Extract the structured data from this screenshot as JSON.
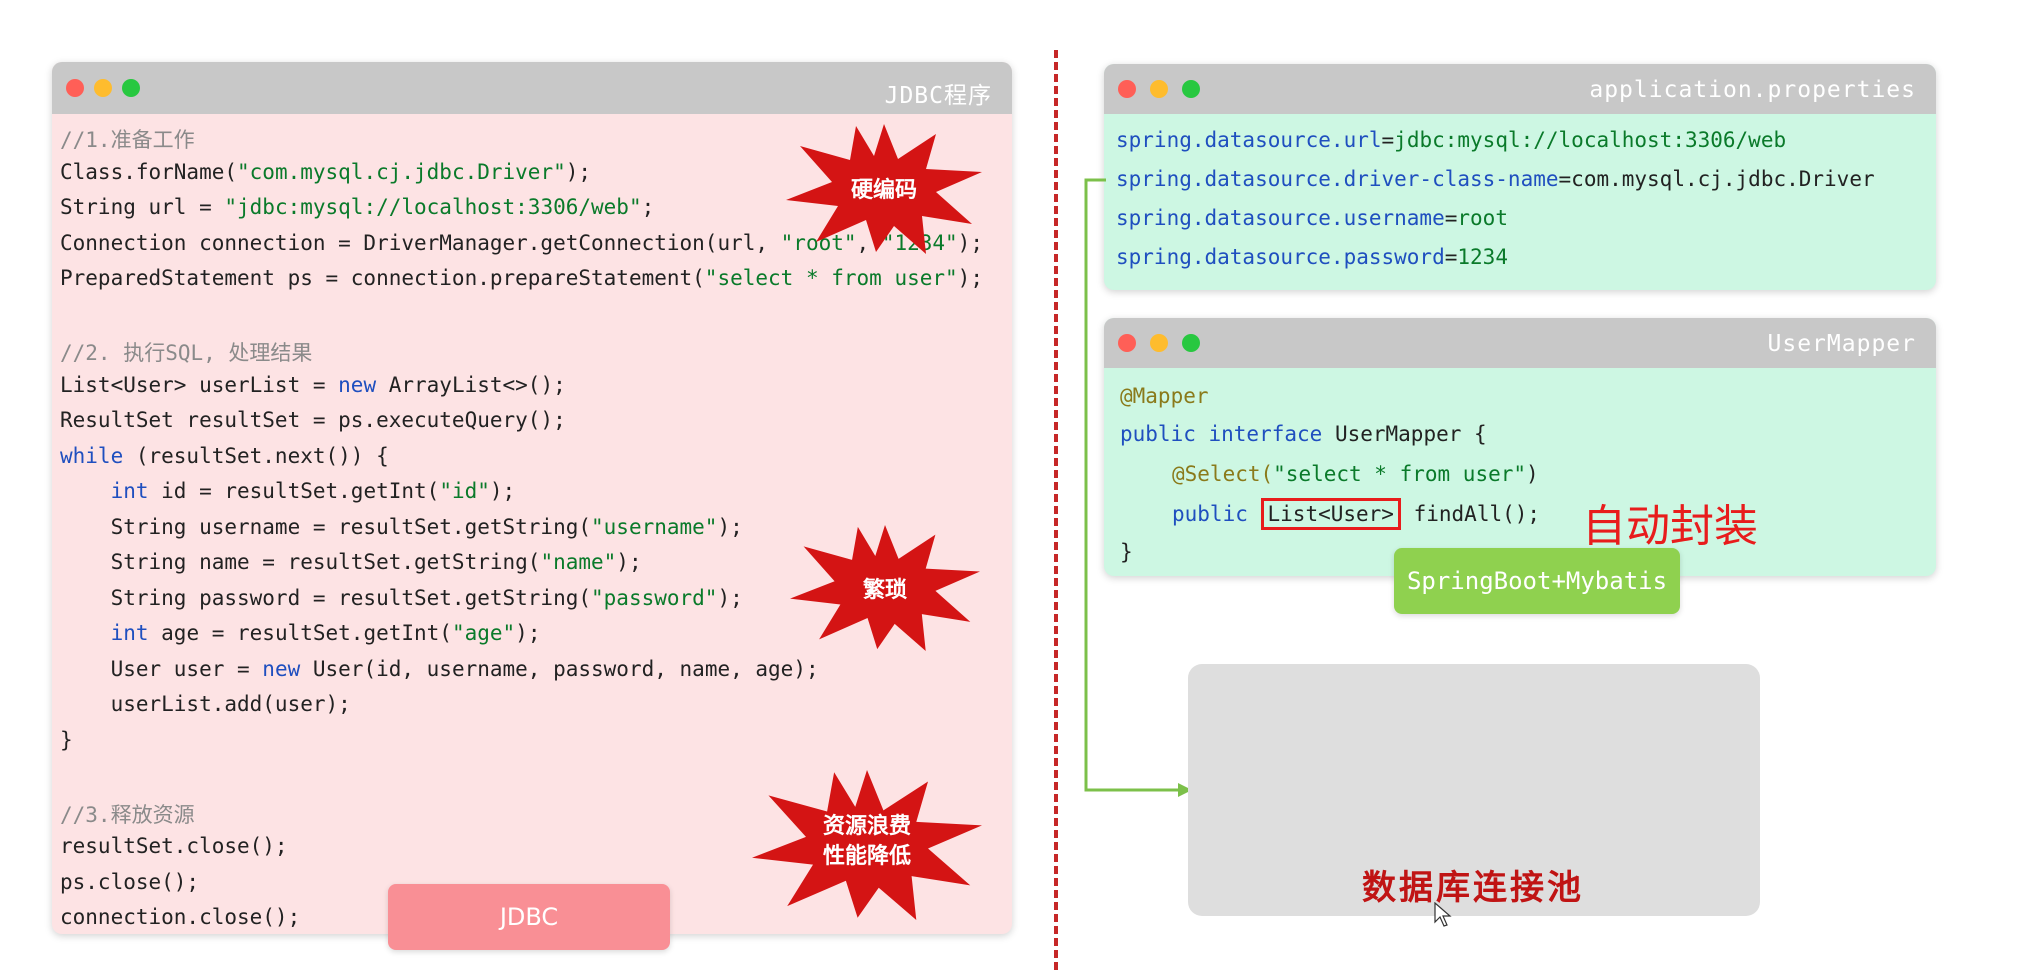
{
  "jdbc_window": {
    "title": "JDBC程序",
    "lines": [
      "//1.准备工作",
      "Class.forName(\"com.mysql.cj.jdbc.Driver\");",
      "String url = \"jdbc:mysql://localhost:3306/web\";",
      "Connection connection = DriverManager.getConnection(url, \"root\", \"1234\");",
      "PreparedStatement ps = connection.prepareStatement(\"select * from user\");",
      "",
      "//2. 执行SQL, 处理结果",
      "List<User> userList = new ArrayList<>();",
      "ResultSet resultSet = ps.executeQuery();",
      "while (resultSet.next()) {",
      "    int id = resultSet.getInt(\"id\");",
      "    String username = resultSet.getString(\"username\");",
      "    String name = resultSet.getString(\"name\");",
      "    String password = resultSet.getString(\"password\");",
      "    int age = resultSet.getInt(\"age\");",
      "    User user = new User(id, username, password, name, age);",
      "    userList.add(user);",
      "}",
      "",
      "//3.释放资源",
      "resultSet.close();",
      "ps.close();",
      "connection.close();"
    ],
    "bursts": [
      {
        "text": "硬编码"
      },
      {
        "text": "繁琐"
      },
      {
        "text": "资源浪费\n性能降低"
      }
    ],
    "badge": "JDBC"
  },
  "properties_window": {
    "title": "application.properties",
    "lines": [
      {
        "key": "spring.datasource.url",
        "value": "jdbc:mysql://localhost:3306/web"
      },
      {
        "key": "spring.datasource.driver-class-name",
        "value": "com.mysql.cj.jdbc.Driver"
      },
      {
        "key": "spring.datasource.username",
        "value": "root"
      },
      {
        "key": "spring.datasource.password",
        "value": "1234"
      }
    ]
  },
  "mapper_window": {
    "title": "UserMapper",
    "annotation": "@Mapper",
    "decl_kw": "public interface",
    "decl_name": "UserMapper {",
    "select_annotation": "@Select(",
    "select_sql": "\"select * from user\"",
    "select_close": ")",
    "method_kw": "public",
    "return_type": "List<User>",
    "method_name": "findAll();",
    "close_brace": "}",
    "callout": "自动封装",
    "badge": "SpringBoot+Mybatis"
  },
  "pool_box": {
    "label": "数据库连接池"
  },
  "colors": {
    "jdbc_bg": "#fde3e4",
    "config_bg": "#cdf7e3",
    "burst_red": "#d41414",
    "green_badge": "#8fd14f",
    "pink_badge": "#f98f95",
    "callout_red": "#e81c1c",
    "connector_green": "#7cc04a"
  }
}
